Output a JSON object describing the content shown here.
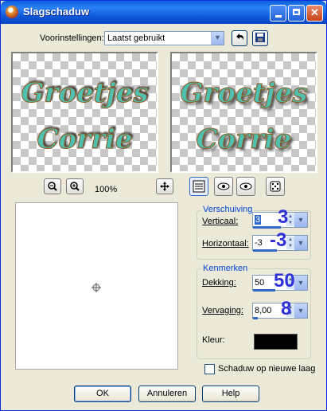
{
  "window": {
    "title": "Slagschaduw",
    "controls": {
      "minimize": "",
      "maximize": "",
      "close": "✕"
    }
  },
  "presets": {
    "label": "Voorinstellingen:",
    "value": "Laatst gebruikt"
  },
  "preview": {
    "line1": "Groetjes",
    "line2": "Corrie",
    "zoom": "100%"
  },
  "offset_group": {
    "title": "Verschuiving",
    "vertical_label": "Verticaal:",
    "vertical_value": "3",
    "horizontal_label": "Horizontaal:",
    "horizontal_value": "-3",
    "vertical_overlay": "3",
    "horizontal_overlay": "-3"
  },
  "properties_group": {
    "title": "Kenmerken",
    "opacity_label": "Dekking:",
    "opacity_value": "50",
    "opacity_overlay": "50",
    "blur_label": "Vervaging:",
    "blur_value": "8,00",
    "blur_overlay": "8",
    "color_label": "Kleur:",
    "color": "#000000"
  },
  "new_layer": {
    "label": "Schaduw op nieuwe laag",
    "checked": false
  },
  "buttons": {
    "ok": "OK",
    "cancel": "Annuleren",
    "help": "Help"
  }
}
